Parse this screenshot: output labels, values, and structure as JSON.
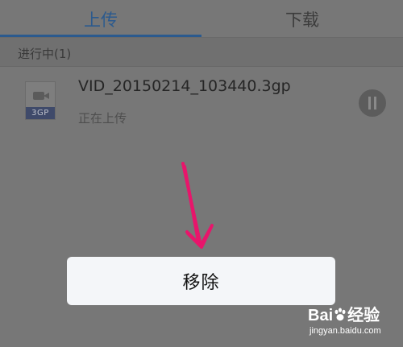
{
  "tabs": {
    "upload_label": "上传",
    "download_label": "下载",
    "active": "upload"
  },
  "section": {
    "in_progress_label": "进行中(1)"
  },
  "file": {
    "name": "VID_20150214_103440.3gp",
    "type_badge": "3GP",
    "status": "正在上传"
  },
  "action_sheet": {
    "remove_label": "移除"
  },
  "watermark": {
    "brand_prefix": "Bai",
    "brand_suffix": "经验",
    "url": "jingyan.baidu.com"
  },
  "colors": {
    "accent": "#2b5a8e",
    "overlay": "#777777",
    "annotation_arrow": "#e8156b"
  },
  "icons": {
    "file_icon": "video-file-icon",
    "pause": "pause-icon"
  }
}
